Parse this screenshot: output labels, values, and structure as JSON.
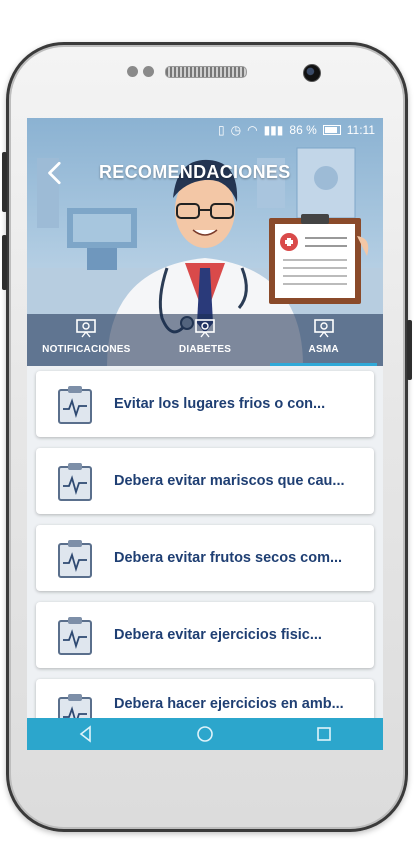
{
  "status": {
    "percent": "86 %",
    "time": "11:11"
  },
  "header": {
    "title": "RECOMENDACIONES"
  },
  "tabs": [
    {
      "label": "NOTIFICACIONES",
      "active": false
    },
    {
      "label": "DIABETES",
      "active": false
    },
    {
      "label": "ASMA",
      "active": true
    }
  ],
  "items": [
    {
      "text": "Evitar los lugares frios o con..."
    },
    {
      "text": "Debera evitar mariscos que cau..."
    },
    {
      "text": "Debera evitar frutos secos com..."
    },
    {
      "text": "Debera evitar ejercicios fisic..."
    },
    {
      "text": "Debera hacer ejercicios en amb..."
    }
  ],
  "colors": {
    "accent": "#2ca6cc",
    "title_text": "#1f3f73",
    "hero": "#8bb2d2"
  },
  "icons": {
    "back": "arrow-left-icon",
    "tab": "presentation-board-icon",
    "item": "clipboard-heartbeat-icon"
  }
}
